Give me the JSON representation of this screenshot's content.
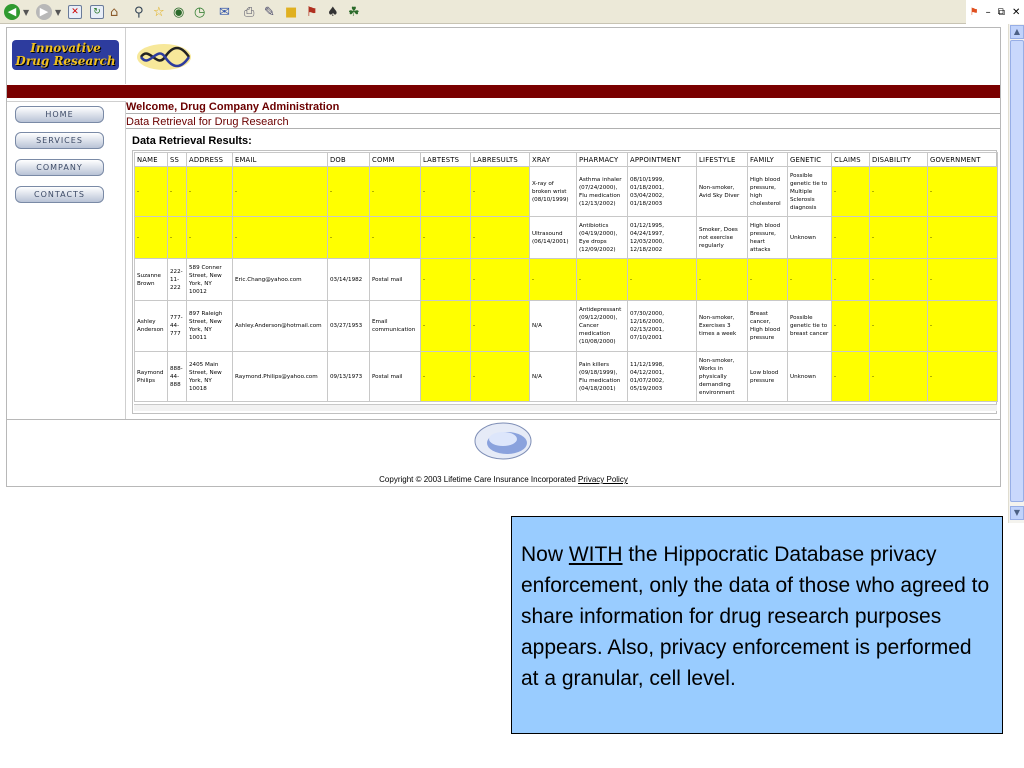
{
  "site": {
    "logo_text": "Innovative Drug Research",
    "welcome": "Welcome, Drug Company Administration",
    "subtitle": "Data Retrieval for Drug Research",
    "results_title": "Data Retrieval Results:",
    "nav": [
      "HOME",
      "SERVICES",
      "COMPANY",
      "CONTACTS"
    ],
    "footer_copyright": "Copyright © 2003 Lifetime Care Insurance Incorporated",
    "footer_link": "Privacy Policy"
  },
  "table": {
    "headers": [
      "NAME",
      "SS",
      "ADDRESS",
      "EMAIL",
      "DOB",
      "COMM",
      "LABTESTS",
      "LABRESULTS",
      "XRAY",
      "PHARMACY",
      "APPOINTMENT",
      "LIFESTYLE",
      "FAMILY",
      "GENETIC",
      "CLAIMS",
      "DISABILITY",
      "GOVERNMENT"
    ],
    "rows": [
      [
        {
          "v": "-",
          "y": true
        },
        {
          "v": "-",
          "y": true
        },
        {
          "v": "-",
          "y": true
        },
        {
          "v": "-",
          "y": true
        },
        {
          "v": "-",
          "y": true
        },
        {
          "v": "-",
          "y": true
        },
        {
          "v": "-",
          "y": true
        },
        {
          "v": "-",
          "y": true
        },
        {
          "v": "X-ray of broken wrist (08/10/1999)",
          "y": false
        },
        {
          "v": "Asthma inhaler (07/24/2000), Flu medication (12/13/2002)",
          "y": false
        },
        {
          "v": "08/10/1999, 01/18/2001, 03/04/2002, 01/18/2003",
          "y": false
        },
        {
          "v": "Non-smoker, Avid Sky Diver",
          "y": false
        },
        {
          "v": "High blood pressure, high cholesterol",
          "y": false
        },
        {
          "v": "Possible genetic tie to Multiple Sclerosis diagnosis",
          "y": false
        },
        {
          "v": "-",
          "y": true
        },
        {
          "v": "-",
          "y": true
        },
        {
          "v": "-",
          "y": true
        }
      ],
      [
        {
          "v": "-",
          "y": true
        },
        {
          "v": "-",
          "y": true
        },
        {
          "v": "-",
          "y": true
        },
        {
          "v": "-",
          "y": true
        },
        {
          "v": "-",
          "y": true
        },
        {
          "v": "-",
          "y": true
        },
        {
          "v": "-",
          "y": true
        },
        {
          "v": "-",
          "y": true
        },
        {
          "v": "Ultrasound (06/14/2001)",
          "y": false
        },
        {
          "v": "Antibiotics (04/19/2000), Eye drops (12/09/2002)",
          "y": false
        },
        {
          "v": "01/12/1995, 04/24/1997, 12/03/2000, 12/18/2002",
          "y": false
        },
        {
          "v": "Smoker, Does not exercise regularly",
          "y": false
        },
        {
          "v": "High blood pressure, heart attacks",
          "y": false
        },
        {
          "v": "Unknown",
          "y": false
        },
        {
          "v": "-",
          "y": true
        },
        {
          "v": "-",
          "y": true
        },
        {
          "v": "-",
          "y": true
        }
      ],
      [
        {
          "v": "Suzanne Brown",
          "y": false
        },
        {
          "v": "222-11-222",
          "y": false
        },
        {
          "v": "589 Conner Street, New York, NY 10012",
          "y": false
        },
        {
          "v": "Eric.Chang@yahoo.com",
          "y": false
        },
        {
          "v": "03/14/1982",
          "y": false
        },
        {
          "v": "Postal mail",
          "y": false
        },
        {
          "v": "-",
          "y": true
        },
        {
          "v": "-",
          "y": true
        },
        {
          "v": "-",
          "y": true
        },
        {
          "v": "-",
          "y": true
        },
        {
          "v": "-",
          "y": true
        },
        {
          "v": "-",
          "y": true
        },
        {
          "v": "-",
          "y": true
        },
        {
          "v": "-",
          "y": true
        },
        {
          "v": "-",
          "y": true
        },
        {
          "v": "-",
          "y": true
        },
        {
          "v": "-",
          "y": true
        }
      ],
      [
        {
          "v": "Ashley Anderson",
          "y": false
        },
        {
          "v": "777-44-777",
          "y": false
        },
        {
          "v": "897 Raleigh Street, New York, NY 10011",
          "y": false
        },
        {
          "v": "Ashley.Anderson@hotmail.com",
          "y": false
        },
        {
          "v": "03/27/1953",
          "y": false
        },
        {
          "v": "Email communication",
          "y": false
        },
        {
          "v": "-",
          "y": true
        },
        {
          "v": "-",
          "y": true
        },
        {
          "v": "N/A",
          "y": false
        },
        {
          "v": "Antidepressant (09/12/2000), Cancer medication (10/08/2000)",
          "y": false
        },
        {
          "v": "07/30/2000, 12/16/2000, 02/13/2001, 07/10/2001",
          "y": false
        },
        {
          "v": "Non-smoker, Exercises 3 times a week",
          "y": false
        },
        {
          "v": "Breast cancer, High blood pressure",
          "y": false
        },
        {
          "v": "Possible genetic tie to breast cancer",
          "y": false
        },
        {
          "v": "-",
          "y": true
        },
        {
          "v": "-",
          "y": true
        },
        {
          "v": "-",
          "y": true
        }
      ],
      [
        {
          "v": "Raymond Philips",
          "y": false
        },
        {
          "v": "888-44-888",
          "y": false
        },
        {
          "v": "2405 Main Street, New York, NY 10018",
          "y": false
        },
        {
          "v": "Raymond.Philips@yahoo.com",
          "y": false
        },
        {
          "v": "09/13/1973",
          "y": false
        },
        {
          "v": "Postal mail",
          "y": false
        },
        {
          "v": "-",
          "y": true
        },
        {
          "v": "-",
          "y": true
        },
        {
          "v": "N/A",
          "y": false
        },
        {
          "v": "Pain killers (09/18/1999), Flu medication (04/18/2001)",
          "y": false
        },
        {
          "v": "11/12/1998, 04/12/2001, 01/07/2002, 05/19/2003",
          "y": false
        },
        {
          "v": "Non-smoker, Works in physically demanding environment",
          "y": false
        },
        {
          "v": "Low blood pressure",
          "y": false
        },
        {
          "v": "Unknown",
          "y": false
        },
        {
          "v": "-",
          "y": true
        },
        {
          "v": "-",
          "y": true
        },
        {
          "v": "-",
          "y": true
        }
      ]
    ]
  },
  "note": {
    "part1": "Now ",
    "emphasis": "WITH",
    "part2": " the Hippocratic Database privacy enforcement, only the data of those who agreed to share information for drug research purposes appears. Also, privacy enforcement is performed at a granular, cell level."
  },
  "colors": {
    "header_bar": "#7a0000",
    "title_text": "#6b0000",
    "suppressed_cell": "#ffff00",
    "note_background": "#99ccff"
  },
  "icons": [
    "back-icon",
    "forward-icon",
    "stop-icon",
    "refresh-icon",
    "home-icon",
    "search-icon",
    "favorites-icon",
    "media-icon",
    "history-icon",
    "mail-icon",
    "print-icon",
    "edit-icon",
    "folder-icon",
    "messenger-icon",
    "windows-flag-icon"
  ]
}
